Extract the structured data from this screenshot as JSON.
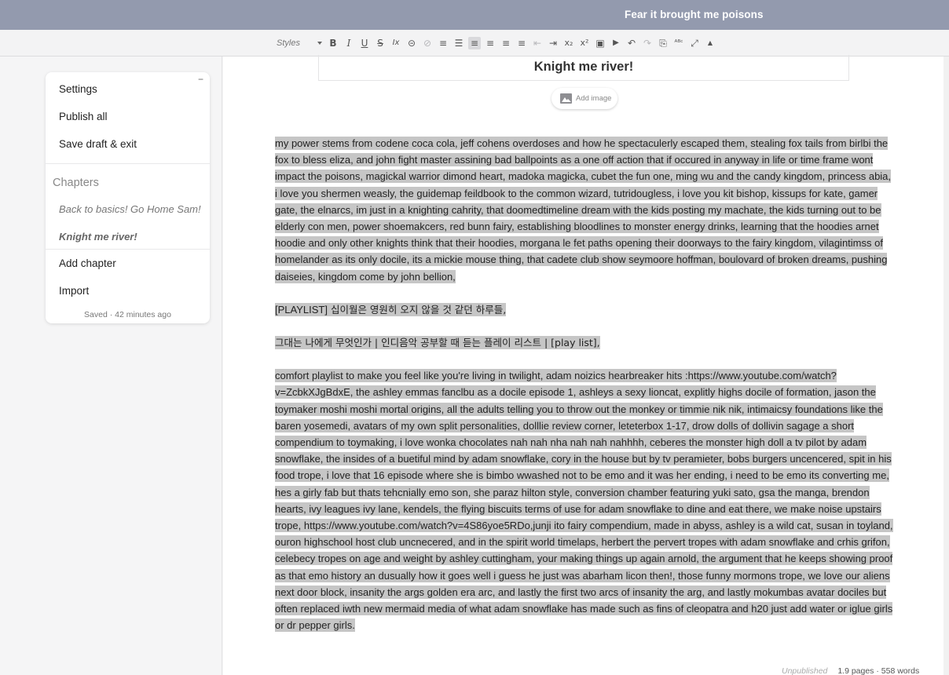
{
  "header": {
    "story_title": "Fear it brought me poisons"
  },
  "toolbar": {
    "styles_label": "Styles",
    "buttons": [
      {
        "name": "bold",
        "glyph": "B"
      },
      {
        "name": "italic",
        "glyph": "I"
      },
      {
        "name": "underline",
        "glyph": "U"
      },
      {
        "name": "strikethrough",
        "glyph": "S"
      },
      {
        "name": "clear-format",
        "glyph": "Ix"
      },
      {
        "name": "link",
        "glyph": "⊝"
      },
      {
        "name": "unlink",
        "glyph": "⊘"
      },
      {
        "name": "numbered-list",
        "glyph": "≡"
      },
      {
        "name": "bulleted-list",
        "glyph": "☰"
      },
      {
        "name": "align-left",
        "glyph": "≡"
      },
      {
        "name": "align-center",
        "glyph": "≡"
      },
      {
        "name": "align-right",
        "glyph": "≡"
      },
      {
        "name": "justify",
        "glyph": "≡"
      },
      {
        "name": "outdent",
        "glyph": "⇤"
      },
      {
        "name": "indent",
        "glyph": "⇥"
      },
      {
        "name": "subscript",
        "glyph": "x₂"
      },
      {
        "name": "superscript",
        "glyph": "x²"
      },
      {
        "name": "image",
        "glyph": "▣"
      },
      {
        "name": "video",
        "glyph": "▶"
      },
      {
        "name": "undo",
        "glyph": "↶"
      },
      {
        "name": "redo",
        "glyph": "↷"
      },
      {
        "name": "paste",
        "glyph": "⎘"
      },
      {
        "name": "spellcheck",
        "glyph": "ᴬᴮᶜ"
      },
      {
        "name": "fullscreen",
        "glyph": "⤢"
      },
      {
        "name": "collapse-toolbar",
        "glyph": "▲"
      }
    ]
  },
  "sidebar": {
    "collapse_glyph": "−",
    "settings": "Settings",
    "publish_all": "Publish all",
    "save_draft": "Save draft & exit",
    "chapters_heading": "Chapters",
    "chapters": [
      {
        "label": "Back to basics! Go Home Sam!"
      },
      {
        "label": "Knight me river!"
      }
    ],
    "add_chapter": "Add chapter",
    "import": "Import",
    "saved_status": "Saved · 42 minutes ago"
  },
  "editor": {
    "chapter_title": "Knight me river!",
    "add_image": "Add image",
    "paragraphs": {
      "p1": "my power stems from codene coca cola, jeff cohens overdoses and how he spectaculerly escaped them, stealing fox tails from birlbi the fox to bless eliza, and john fight master assining bad ballpoints as a one off action that if occured in anyway in life or time frame wont impact the poisons, magickal warrior dimond heart, madoka magicka, cubet the fun one, ming wu and the candy kingdom, princess abia, i love you shermen weasly, the guidemap feildbook to the common wizard, tutridougless, i love you kit bishop, kissups for kate, gamer gate, the elnarcs, im just in a knighting cahrity, that doomedtimeline dream with the kids posting my machate, the kids turning out to be elderly con men, power shoemakcers, red bunn fairy, establishing bloodlines to monster energy drinks, learning that the hoodies arnet hoodie and only other knights think that their hoodies, morgana le fet paths opening their doorways to the fairy kingdom, vilagintimss of homelander as its only docile, its a mickie mouse thing, that cadete club show seymoore hoffman, boulovard of broken dreams, pushing daiseies, kingdom come by john bellion,",
      "p2_tag": "[PLAYLIST]",
      "p2_text": " 십이월은 영원히 오지 않을 것 같던 하루들,",
      "p3": "그대는 나에게 무엇인가 | 인디음악 공부할 때 듣는 플레이 리스트 | [play list],",
      "p4": "comfort playlist to make you feel like you're living in twilight, adam noizics hearbreaker hits :https://www.youtube.com/watch?v=ZcbkXJgBdxE, the ashley emmas fanclbu as a docile episode 1, ashleys a sexy lioncat, explitly highs docile of formation, jason the toymaker moshi moshi mortal origins, all the adults telling you to throw out the monkey or timmie nik nik, intimaicsy foundations like the baren yosemedi, avatars of my own split personalities, dolllie review corner, leteterbox 1-17, drow dolls of dollivin sagage a short compendium to toymaking, i love wonka chocolates nah nah nha nah nah nahhhh, ceberes the monster high doll a tv pilot by adam snowflake, the insides of a buetiful mind by adam snowflake, cory in the house but by tv peramieter, bobs burgers uncencered, spit in his food trope, i love that 16 episode where she is bimbo wwashed not to be emo and it was her ending, i need to be emo its converting me, hes a girly fab but thats tehcnially emo son, she paraz hilton style, conversion chamber featuring yuki sato, gsa the manga, brendon hearts, ivy leagues ivy lane, kendels, the flying biscuits terms of use for adam snowflake to dine and eat there, we make noise upstairs trope, https://www.youtube.com/watch?v=4S86yoe5RDo,junji ito fairy compendium, made in abyss, ashley is a wild cat, susan in toyland, ouron highschool host club uncnecered, and in the spirit world timelaps, herbert the pervert tropes with adam snowflake and crhis grifon, celebecy tropes on age and weight by ashley cuttingham, your making things up again arnold, the argument that he keeps showing proof as that emo history an dusually how it goes well i guess he just was abarham licon then!, those funny mormons trope, we love our aliens next door block, insanity the args golden era arc, and lastly the first two arcs of insanity the arg, and lastly mokumbas avatar dociles but often replaced iwth new mermaid media of what adam snowflake has made such as fins of cleopatra and h20 just add water or iglue girls or dr pepper girls."
    }
  },
  "status": {
    "publish_state": "Unpublished",
    "counts": "1.9 pages · 558 words"
  },
  "colors": {
    "topbar": "#939aae",
    "selection": "#c6c6c6"
  }
}
